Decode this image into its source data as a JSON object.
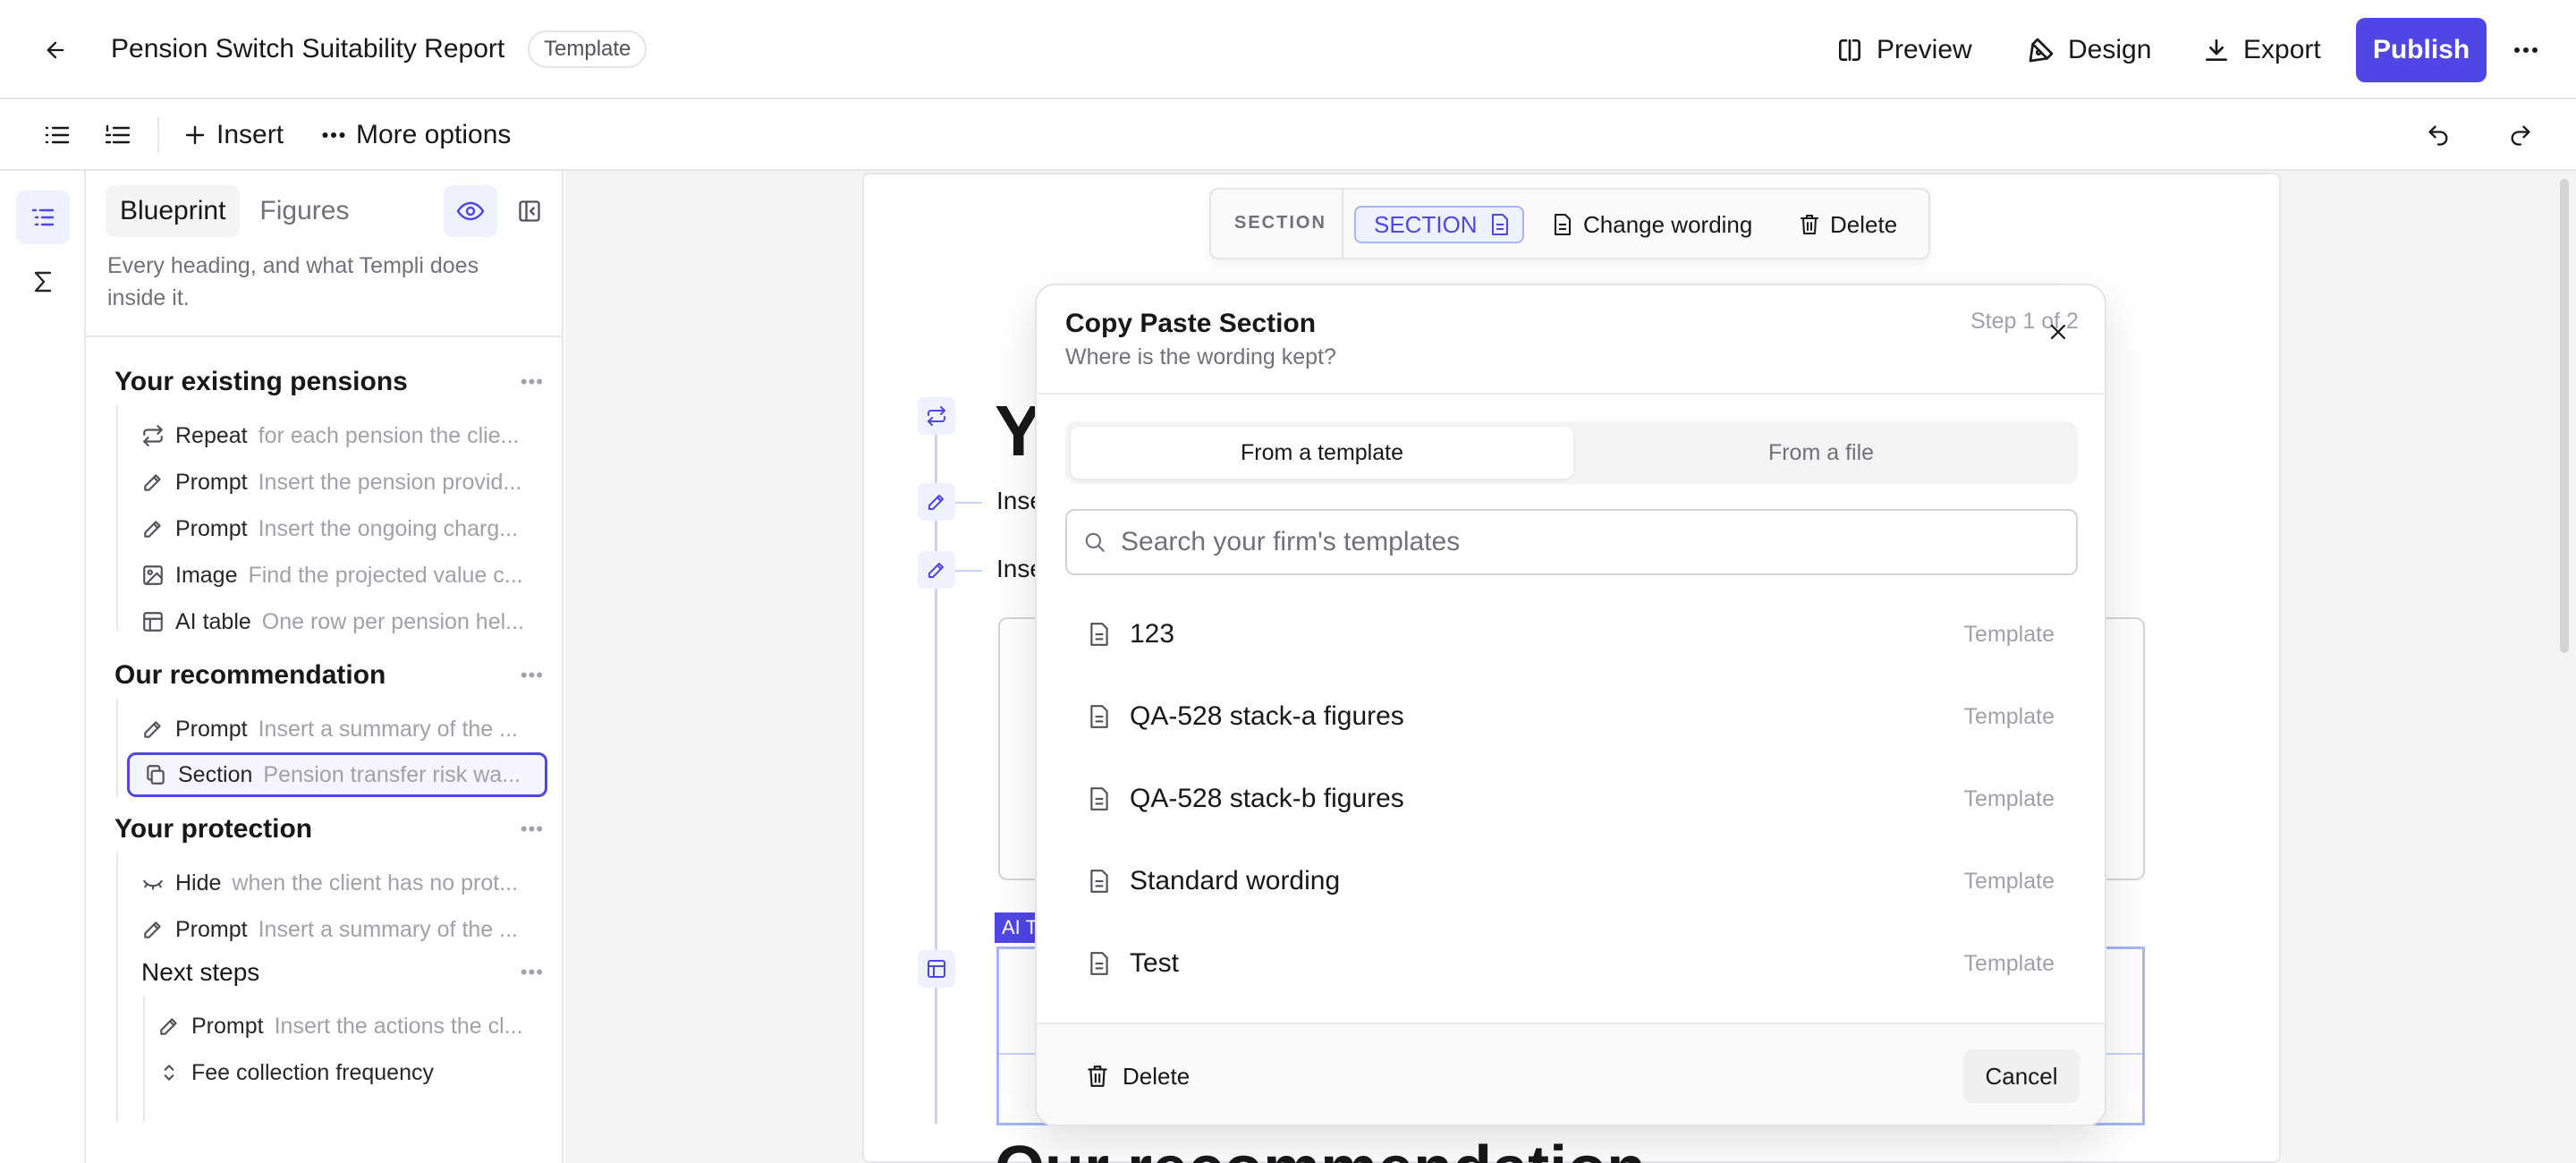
{
  "header": {
    "title": "Pension Switch Suitability Report",
    "badge": "Template",
    "preview_label": "Preview",
    "design_label": "Design",
    "export_label": "Export",
    "publish_label": "Publish"
  },
  "toolbar": {
    "insert_label": "Insert",
    "more_label": "More options"
  },
  "panel": {
    "tabs": [
      "Blueprint",
      "Figures"
    ],
    "description": "Every heading, and what Templi does inside it.",
    "sections": [
      {
        "title": "Your existing pensions",
        "items": [
          {
            "kind": "Repeat",
            "text": "for each pension the clie...",
            "icon": "repeat-icon"
          },
          {
            "kind": "Prompt",
            "text": "Insert the pension provid...",
            "icon": "pencil-icon"
          },
          {
            "kind": "Prompt",
            "text": "Insert the ongoing charg...",
            "icon": "pencil-icon"
          },
          {
            "kind": "Image",
            "text": "Find the projected value c...",
            "icon": "image-icon"
          },
          {
            "kind": "AI table",
            "text": "One row per pension hel...",
            "icon": "table-icon"
          }
        ]
      },
      {
        "title": "Our recommendation",
        "items": [
          {
            "kind": "Prompt",
            "text": "Insert a summary of the ...",
            "icon": "pencil-icon"
          },
          {
            "kind": "Section",
            "text": "Pension transfer risk wa...",
            "icon": "copy-icon"
          }
        ]
      },
      {
        "title": "Your protection",
        "items": [
          {
            "kind": "Hide",
            "text": "when the client has no prot...",
            "icon": "eye-closed-icon"
          },
          {
            "kind": "Prompt",
            "text": "Insert a summary of the ...",
            "icon": "pencil-icon"
          }
        ]
      },
      {
        "title": "Next steps",
        "items": [
          {
            "kind": "Prompt",
            "text": "Insert the actions the cl...",
            "icon": "pencil-icon"
          },
          {
            "kind": "Fee collection frequency",
            "text": "",
            "icon": "chevron-updown-icon"
          }
        ]
      }
    ]
  },
  "section_toolbar": {
    "label": "SECTION",
    "chip": "SECTION",
    "change_wording": "Change wording",
    "delete": "Delete"
  },
  "canvas": {
    "heading_fragment": "Yo",
    "line1_fragment": "Inse",
    "line2_fragment": "Inse",
    "ai_tag": "AI T",
    "heading2_fragment": "Our recommendation"
  },
  "modal": {
    "title": "Copy Paste Section",
    "subtitle": "Where is the wording kept?",
    "step": "Step 1 of 2",
    "tabs": [
      "From a template",
      "From a file"
    ],
    "search_placeholder": "Search your firm's templates",
    "templates": [
      {
        "name": "123",
        "kind": "Template"
      },
      {
        "name": "QA-528 stack-a figures",
        "kind": "Template"
      },
      {
        "name": "QA-528 stack-b figures",
        "kind": "Template"
      },
      {
        "name": "Standard wording",
        "kind": "Template"
      },
      {
        "name": "Test",
        "kind": "Template"
      }
    ],
    "delete_label": "Delete",
    "cancel_label": "Cancel"
  },
  "colors": {
    "accent": "#4f46e5",
    "accent_light": "#eef2ff"
  }
}
